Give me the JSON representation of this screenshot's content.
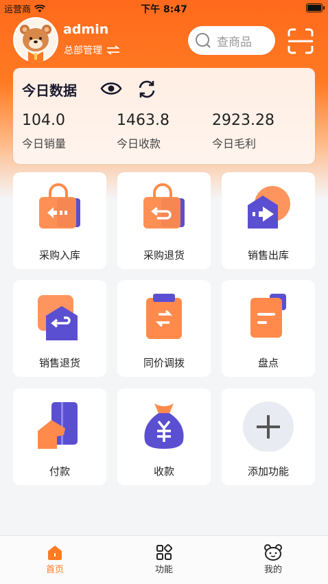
{
  "status_bar": {
    "carrier": "运营商",
    "time": "下午 8:47"
  },
  "header": {
    "username": "admin",
    "org": "总部管理",
    "search_placeholder": "查商品"
  },
  "today": {
    "title": "今日数据",
    "stats": [
      {
        "value": "104.0",
        "label": "今日销量"
      },
      {
        "value": "1463.8",
        "label": "今日收款"
      },
      {
        "value": "2923.28",
        "label": "今日毛利"
      }
    ]
  },
  "functions": [
    {
      "label": "采购入库",
      "icon": "purchase-in-icon"
    },
    {
      "label": "采购退货",
      "icon": "purchase-return-icon"
    },
    {
      "label": "销售出库",
      "icon": "sales-out-icon"
    },
    {
      "label": "销售退货",
      "icon": "sales-return-icon"
    },
    {
      "label": "同价调拨",
      "icon": "transfer-icon"
    },
    {
      "label": "盘点",
      "icon": "inventory-icon"
    },
    {
      "label": "付款",
      "icon": "payment-icon"
    },
    {
      "label": "收款",
      "icon": "receipt-icon"
    },
    {
      "label": "添加功能",
      "icon": "add-icon"
    }
  ],
  "tabbar": {
    "items": [
      {
        "label": "首页",
        "icon": "home-icon",
        "active": true
      },
      {
        "label": "功能",
        "icon": "grid-icon",
        "active": false
      },
      {
        "label": "我的",
        "icon": "bear-icon",
        "active": false
      }
    ]
  },
  "colors": {
    "accent": "#ff7a22",
    "purple": "#5b4fd1",
    "orange": "#ff8a4c"
  }
}
